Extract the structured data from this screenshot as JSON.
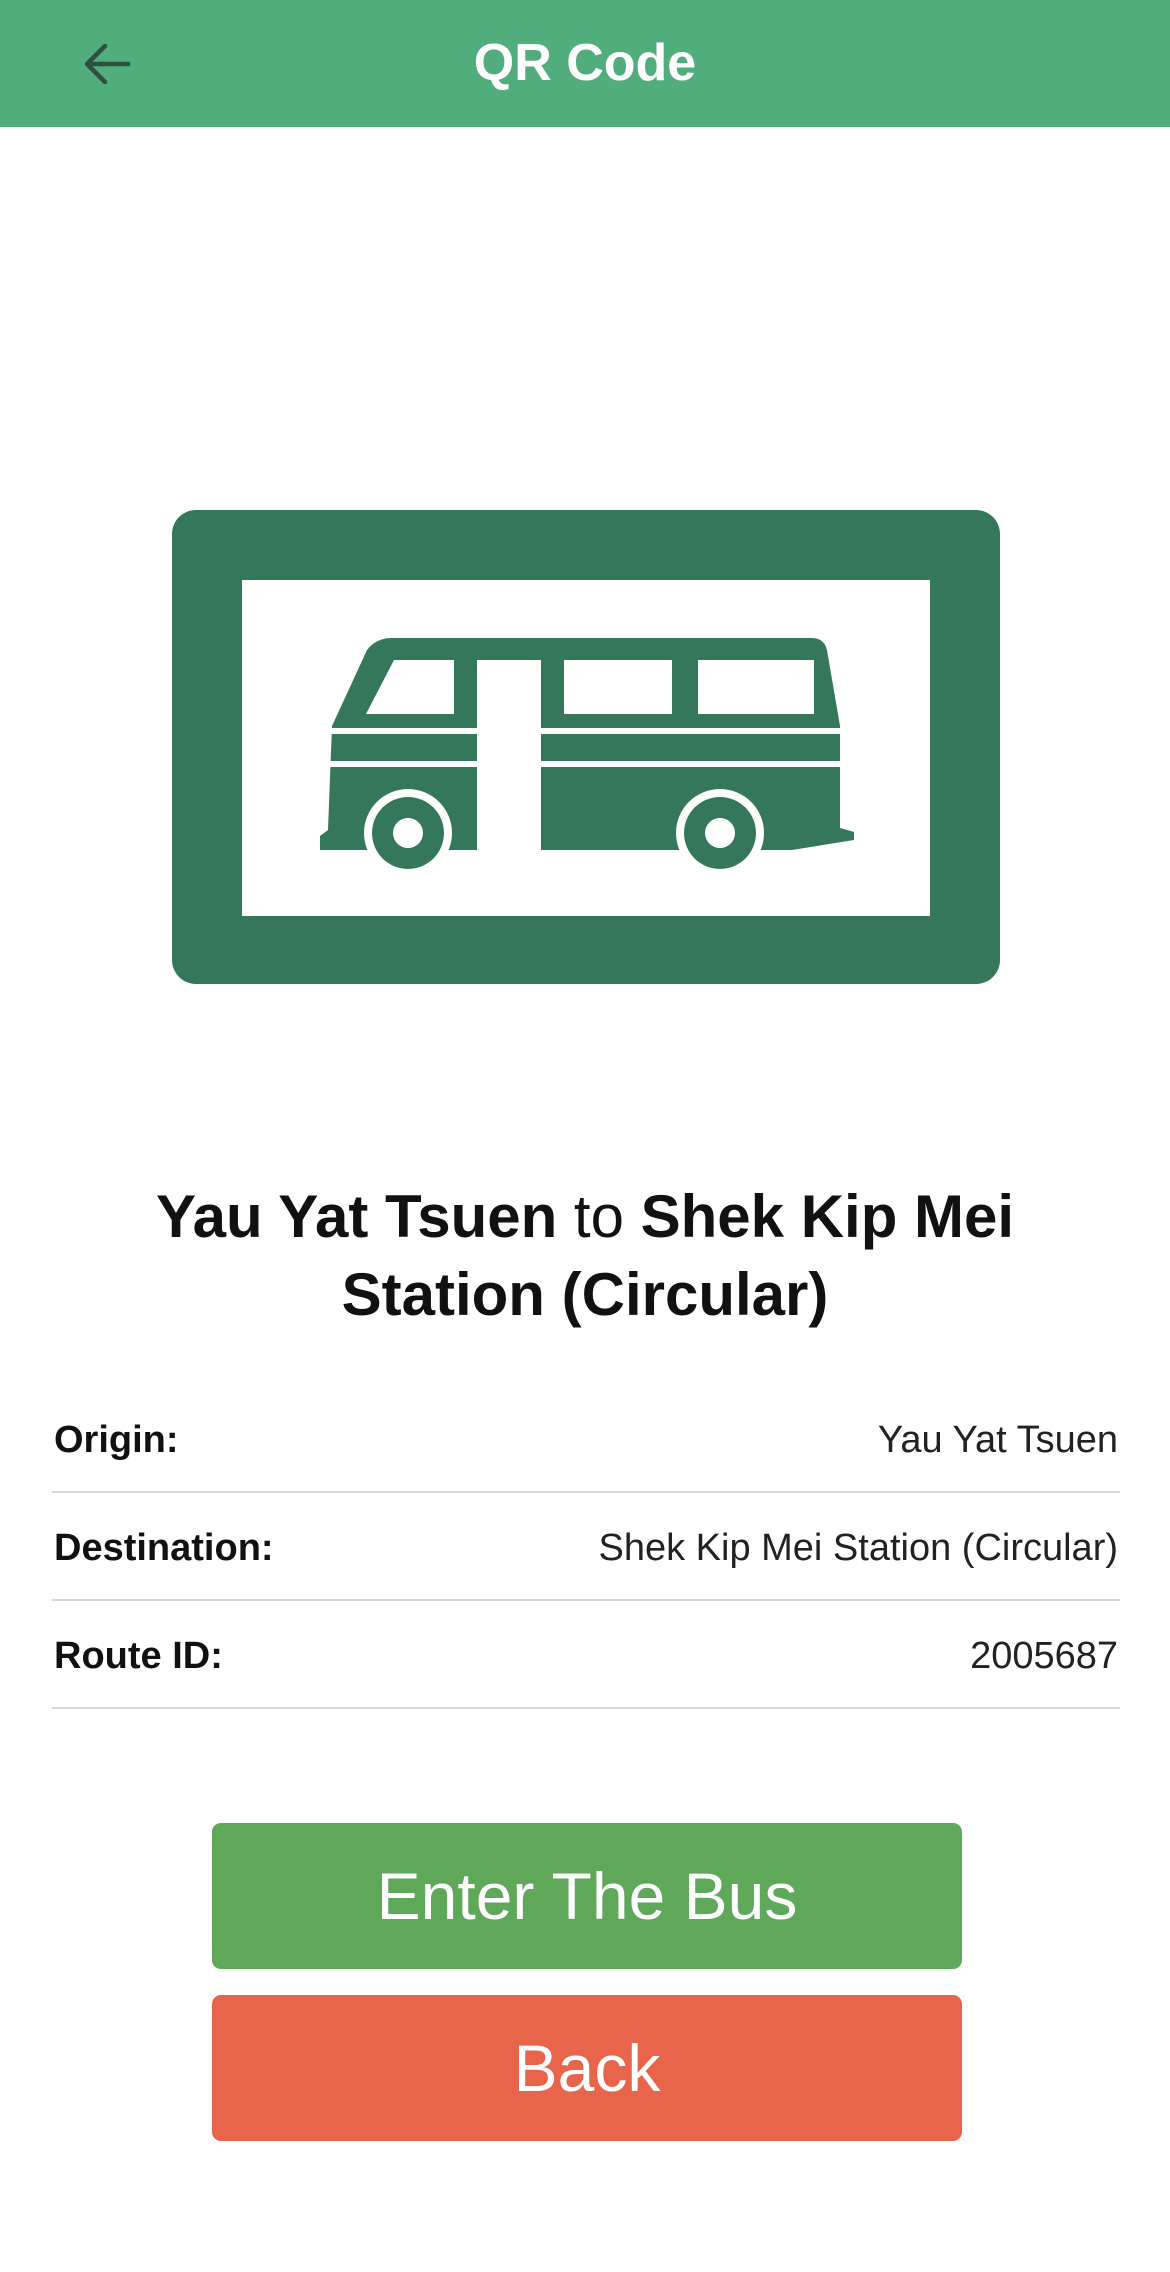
{
  "header": {
    "title": "QR Code",
    "back_icon": "arrow-left-icon"
  },
  "sign": {
    "icon": "minibus-icon",
    "frame_color": "#35775a"
  },
  "route_title": {
    "origin": "Yau Yat Tsuen",
    "connector": "to",
    "destination": "Shek Kip Mei Station (Circular)"
  },
  "details": [
    {
      "label": "Origin:",
      "value": "Yau Yat Tsuen"
    },
    {
      "label": "Destination:",
      "value": "Shek Kip Mei Station (Circular)"
    },
    {
      "label": "Route ID:",
      "value": "2005687"
    }
  ],
  "buttons": {
    "enter_label": "Enter The Bus",
    "back_label": "Back"
  },
  "colors": {
    "header": "#52ad7d",
    "enter_button": "#5fa85a",
    "back_button": "#e8644b"
  }
}
